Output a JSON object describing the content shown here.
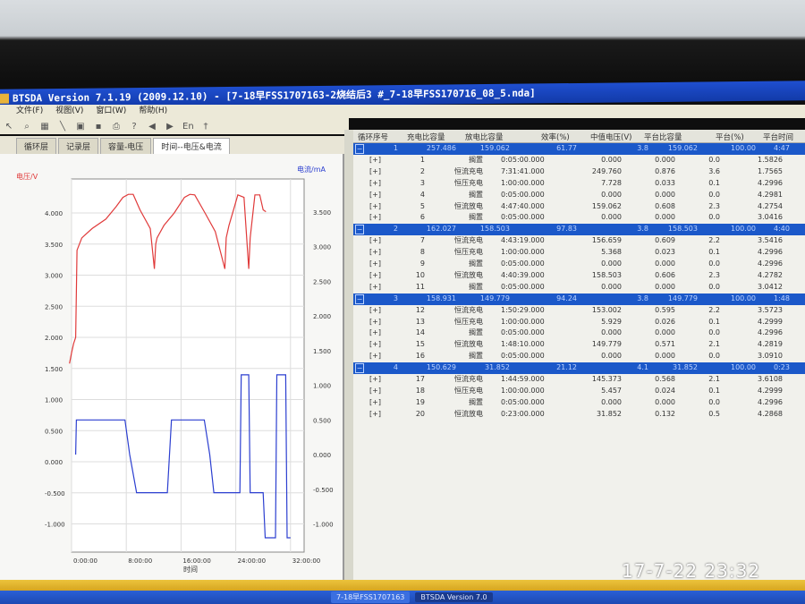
{
  "window": {
    "title": "BTSDA Version 7.1.19 (2009.12.10)   - [7-18早FSS1707163-2烧结后3 #_7-18早FSS170716_08_5.nda]"
  },
  "menu": [
    "文件(F)",
    "视图(V)",
    "窗口(W)",
    "帮助(H)"
  ],
  "toolbar": [
    "pointer-icon",
    "zoom-icon",
    "grid-icon",
    "line-icon",
    "open-icon",
    "save-icon",
    "print-icon",
    "help-icon",
    "back-icon",
    "forward-icon",
    "En",
    "cursor-icon"
  ],
  "tabs": [
    {
      "label": "循环层"
    },
    {
      "label": "记录层"
    },
    {
      "label": "容量-电压"
    },
    {
      "label": "时间--电压&电流",
      "active": true
    }
  ],
  "chart_data": {
    "type": "line",
    "xlabel": "时间",
    "ylabel_left": "电压/V",
    "ylabel_right": "电流/mA",
    "x_ticks": [
      "0:00:00",
      "8:00:00",
      "16:00:00",
      "24:00:00",
      "32:00:00"
    ],
    "x_tick_values": [
      0,
      8,
      16,
      24,
      32
    ],
    "y_left_ticks": [
      "4.000",
      "3.500",
      "3.000",
      "2.500",
      "2.000",
      "1.500",
      "1.000",
      "0.500",
      "0.000",
      "-0.500",
      "-1.000"
    ],
    "y_right_ticks": [
      "3.500",
      "3.000",
      "2.500",
      "2.000",
      "1.500",
      "1.000",
      "0.500",
      "0.000",
      "-0.500",
      "-1.000"
    ],
    "grid": true,
    "colors": {
      "voltage": "#e03a3a",
      "current": "#2c3fd0"
    },
    "series": [
      {
        "axis": "left",
        "color": "#e03a3a",
        "x": [
          -0.3,
          0,
          0.3,
          0.6,
          0.8,
          1.5,
          3,
          5,
          6.5,
          7.5,
          8.3,
          9,
          10,
          11.5,
          12.1,
          12.3,
          12.5,
          13.5,
          15,
          16.5,
          17.3,
          18,
          19.5,
          21,
          22.4,
          22.6,
          23,
          23.8,
          24.3,
          25.2,
          25.9,
          26.1,
          26.8,
          27.5,
          28,
          28.4
        ],
        "y": [
          1.58,
          1.75,
          1.9,
          2.0,
          3.4,
          3.6,
          3.75,
          3.9,
          4.1,
          4.25,
          4.3,
          4.3,
          4.05,
          3.75,
          3.1,
          3.5,
          3.6,
          3.8,
          4.0,
          4.25,
          4.3,
          4.29,
          4.0,
          3.7,
          3.1,
          3.6,
          3.8,
          4.1,
          4.29,
          4.25,
          3.1,
          3.6,
          4.29,
          4.29,
          4.05,
          4.02
        ]
      },
      {
        "axis": "right",
        "color": "#2c3fd0",
        "x": [
          0.6,
          0.7,
          7.8,
          8.5,
          9.5,
          14,
          14.6,
          19.4,
          20.2,
          20.8,
          24.6,
          24.8,
          25.9,
          26.1,
          28.0,
          28.3,
          29.8,
          30.0,
          31.3,
          31.5,
          32.0
        ],
        "y": [
          0.0,
          0.5,
          0.5,
          0.0,
          -0.55,
          -0.55,
          0.5,
          0.5,
          0.0,
          -0.55,
          -0.55,
          1.15,
          1.15,
          -0.55,
          -0.55,
          -1.2,
          -1.2,
          1.15,
          1.15,
          -1.2,
          -1.2
        ]
      }
    ]
  },
  "table": {
    "columns": [
      "循环序号",
      "充电比容量",
      "放电比容量",
      "效率(%)",
      "中值电压(V)",
      "平台比容量",
      "平台(%)",
      "平台时间"
    ],
    "cycles": [
      {
        "values": [
          "1",
          "257.486",
          "159.062",
          "61.77",
          "3.8",
          "159.062",
          "100.00",
          "4:47"
        ],
        "steps": [
          [
            "1",
            "搁置",
            "0:05:00.000",
            "0.000",
            "0.000",
            "0.0",
            "1.5826"
          ],
          [
            "2",
            "恒流充电",
            "7:31:41.000",
            "249.760",
            "0.876",
            "3.6",
            "1.7565"
          ],
          [
            "3",
            "恒压充电",
            "1:00:00.000",
            "7.728",
            "0.033",
            "0.1",
            "4.2996"
          ],
          [
            "4",
            "搁置",
            "0:05:00.000",
            "0.000",
            "0.000",
            "0.0",
            "4.2981"
          ],
          [
            "5",
            "恒流放电",
            "4:47:40.000",
            "159.062",
            "0.608",
            "2.3",
            "4.2754"
          ],
          [
            "6",
            "搁置",
            "0:05:00.000",
            "0.000",
            "0.000",
            "0.0",
            "3.0416"
          ]
        ]
      },
      {
        "values": [
          "2",
          "162.027",
          "158.503",
          "97.83",
          "3.8",
          "158.503",
          "100.00",
          "4:40"
        ],
        "steps": [
          [
            "7",
            "恒流充电",
            "4:43:19.000",
            "156.659",
            "0.609",
            "2.2",
            "3.5416"
          ],
          [
            "8",
            "恒压充电",
            "1:00:00.000",
            "5.368",
            "0.023",
            "0.1",
            "4.2996"
          ],
          [
            "9",
            "搁置",
            "0:05:00.000",
            "0.000",
            "0.000",
            "0.0",
            "4.2996"
          ],
          [
            "10",
            "恒流放电",
            "4:40:39.000",
            "158.503",
            "0.606",
            "2.3",
            "4.2782"
          ],
          [
            "11",
            "搁置",
            "0:05:00.000",
            "0.000",
            "0.000",
            "0.0",
            "3.0412"
          ]
        ]
      },
      {
        "values": [
          "3",
          "158.931",
          "149.779",
          "94.24",
          "3.8",
          "149.779",
          "100.00",
          "1:48"
        ],
        "steps": [
          [
            "12",
            "恒流充电",
            "1:50:29.000",
            "153.002",
            "0.595",
            "2.2",
            "3.5723"
          ],
          [
            "13",
            "恒压充电",
            "1:00:00.000",
            "5.929",
            "0.026",
            "0.1",
            "4.2999"
          ],
          [
            "14",
            "搁置",
            "0:05:00.000",
            "0.000",
            "0.000",
            "0.0",
            "4.2996"
          ],
          [
            "15",
            "恒流放电",
            "1:48:10.000",
            "149.779",
            "0.571",
            "2.1",
            "4.2819"
          ],
          [
            "16",
            "搁置",
            "0:05:00.000",
            "0.000",
            "0.000",
            "0.0",
            "3.0910"
          ]
        ]
      },
      {
        "values": [
          "4",
          "150.629",
          "31.852",
          "21.12",
          "4.1",
          "31.852",
          "100.00",
          "0:23"
        ],
        "steps": [
          [
            "17",
            "恒流充电",
            "1:44:59.000",
            "145.373",
            "0.568",
            "2.1",
            "3.6108"
          ],
          [
            "18",
            "恒压充电",
            "1:00:00.000",
            "5.457",
            "0.024",
            "0.1",
            "4.2999"
          ],
          [
            "19",
            "搁置",
            "0:05:00.000",
            "0.000",
            "0.000",
            "0.0",
            "4.2996"
          ],
          [
            "20",
            "恒流放电",
            "0:23:00.000",
            "31.852",
            "0.132",
            "0.5",
            "4.2868"
          ]
        ]
      }
    ],
    "expand_label": "[+]",
    "collapse_label": "−"
  },
  "taskbar": [
    {
      "label": "7-18早FSS1707163"
    },
    {
      "label": "BTSDA Version 7.0",
      "active": true
    }
  ],
  "photo_timestamp": "17-7-22 23:32"
}
